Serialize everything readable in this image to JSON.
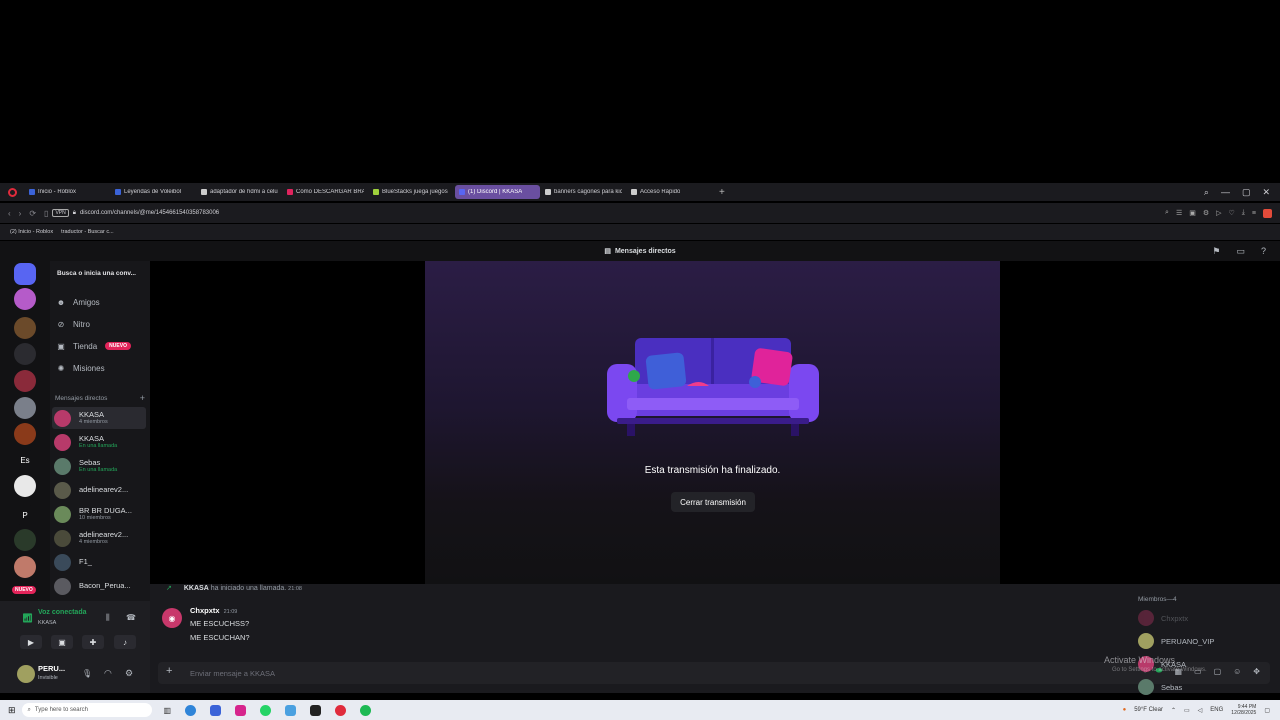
{
  "browser": {
    "tabs": [
      {
        "label": "Inicio - Roblox",
        "color": "#3b63d8",
        "active": false
      },
      {
        "label": "Leyendas de Voleibol",
        "color": "#3b63d8",
        "active": false
      },
      {
        "label": "adaptador de hdmi a celu",
        "color": "#cccccc",
        "active": false
      },
      {
        "label": "Cómo DESCARGAR BRAW",
        "color": "#e0245e",
        "active": false
      },
      {
        "label": "BlueStacks juega juegos",
        "color": "#9fd13c",
        "active": false
      },
      {
        "label": "(1) Discord | KKASA",
        "color": "#5865f2",
        "active": true
      },
      {
        "label": "banners cagones para kick",
        "color": "#cccccc",
        "active": false
      },
      {
        "label": "Acceso Rápido",
        "color": "#cccccc",
        "active": false
      }
    ],
    "url": "discord.com/channels/@me/1454661540358783006",
    "vpn_label": "VPN",
    "bookmarks": [
      {
        "label": "(2) Inicio - Roblox"
      },
      {
        "label": "traductor - Buscar c..."
      }
    ]
  },
  "discord": {
    "top_title": "Mensajes directos",
    "servers": [
      {
        "label": "",
        "color": "#5865f2"
      },
      {
        "label": "",
        "color": "#b55bc9"
      },
      {
        "label": "",
        "color": "#6b4a2a"
      },
      {
        "label": "",
        "color": "#2b2b30"
      },
      {
        "label": "",
        "color": "#8a2a3a"
      },
      {
        "label": "",
        "color": "#7a7f8a"
      },
      {
        "label": "",
        "color": "#8a3a1a"
      },
      {
        "label": "Es",
        "color": "#121214"
      },
      {
        "label": "",
        "color": "#e8e8e8"
      },
      {
        "label": "P",
        "color": "#121214"
      },
      {
        "label": "",
        "color": "#2a3a2a"
      },
      {
        "label": "",
        "color": "#c07a6a"
      }
    ],
    "server_badge": "NUEVO",
    "search_label": "Busca o inicia una conv...",
    "nav": [
      {
        "label": "Amigos",
        "badge": ""
      },
      {
        "label": "Nitro",
        "badge": ""
      },
      {
        "label": "Tienda",
        "badge": "NUEVO"
      },
      {
        "label": "Misiones",
        "badge": ""
      }
    ],
    "dm_header": "Mensajes directos",
    "dm_add": "+",
    "dms": [
      {
        "name": "KKASA",
        "sub": "4 miembros",
        "call": false,
        "color": "#b83a6a",
        "selected": true
      },
      {
        "name": "KKASA",
        "sub": "En una llamada",
        "call": true,
        "color": "#b83a6a",
        "selected": false
      },
      {
        "name": "Sebas",
        "sub": "En una llamada",
        "call": true,
        "color": "#5a7a6a",
        "selected": false
      },
      {
        "name": "adelinearev2...",
        "sub": "",
        "call": false,
        "color": "#5a5a4a",
        "selected": false
      },
      {
        "name": "BR BR DUGA...",
        "sub": "10 miembros",
        "call": false,
        "color": "#6a8a5a",
        "selected": false
      },
      {
        "name": "adelinearev2...",
        "sub": "4 miembros",
        "call": false,
        "color": "#4a4a3a",
        "selected": false
      },
      {
        "name": "F1_",
        "sub": "",
        "call": false,
        "color": "#3a4a5a",
        "selected": false
      },
      {
        "name": "Bacon_Perua...",
        "sub": "",
        "call": false,
        "color": "#5a5a60",
        "selected": false
      }
    ],
    "voice_status": "Voz conectada",
    "voice_channel": "KKASA",
    "user_name": "PERU...",
    "user_status": "Invisible",
    "stream_end_text": "Esta transmisión ha finalizado.",
    "close_stream_label": "Cerrar transmisión",
    "system_message_user": "KKASA",
    "system_message_text": "ha iniciado una llamada.",
    "system_message_time": "21:08",
    "message_author": "Chxpxtx",
    "message_time": "21:09",
    "message_lines": [
      "ME ESCUCHSS?",
      "ME ESCUCHAN?"
    ],
    "composer_placeholder": "Enviar mensaje a KKASA",
    "members_header": "Miembros—4",
    "members": [
      {
        "name": "Chxpxtx",
        "color": "#c8386b",
        "dim": true
      },
      {
        "name": "PERUANO_VIP",
        "color": "#a0a060",
        "dim": false
      },
      {
        "name": "KKASA",
        "color": "#b83a6a",
        "dim": false
      },
      {
        "name": "Sebas",
        "color": "#5a7a6a",
        "dim": false
      }
    ],
    "activate_title": "Activate Windows",
    "activate_sub": "Go to Settings to activate Windows."
  },
  "taskbar": {
    "search_placeholder": "Type here to search",
    "weather": "59°F Clear",
    "lang": "ENG",
    "time": "9:44 PM",
    "date": "12/28/2025"
  }
}
